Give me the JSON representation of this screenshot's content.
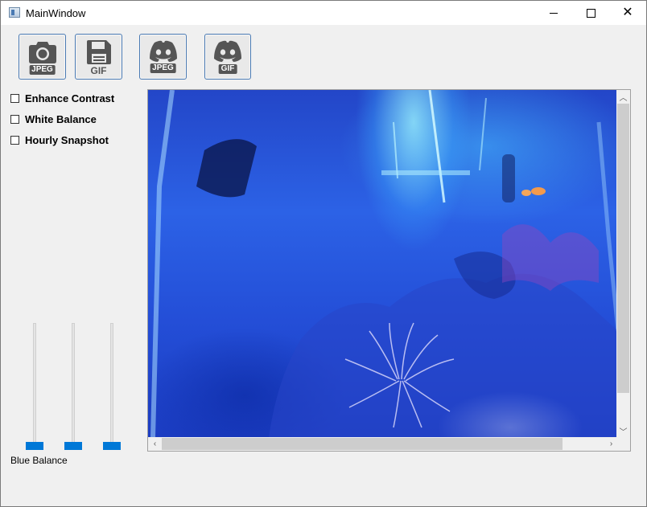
{
  "window": {
    "title": "MainWindow"
  },
  "toolbar": {
    "buttons": [
      {
        "name": "save-jpeg-button",
        "icon": "camera-icon",
        "caption": "JPEG"
      },
      {
        "name": "save-gif-button",
        "icon": "floppy-disk-icon",
        "caption": "GIF"
      },
      {
        "name": "discord-jpeg-button",
        "icon": "discord-icon",
        "caption": "JPEG"
      },
      {
        "name": "discord-gif-button",
        "icon": "discord-icon",
        "caption": "GIF"
      }
    ]
  },
  "options": {
    "enhance_contrast": {
      "label": "Enhance Contrast",
      "checked": false
    },
    "white_balance": {
      "label": "White Balance",
      "checked": false
    },
    "hourly_snapshot": {
      "label": "Hourly Snapshot",
      "checked": false
    }
  },
  "sliders": {
    "label": "Blue Balance",
    "values": [
      0,
      0,
      0
    ]
  },
  "viewer": {
    "image": "aquarium-camera-feed",
    "accent": "#0078d7"
  }
}
